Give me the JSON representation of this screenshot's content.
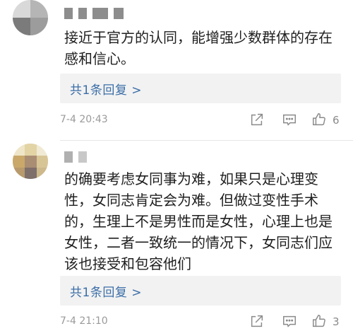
{
  "comments": [
    {
      "text_lines": [
        "接近于官方的认同，能增强少数群体的存在",
        "感和信心。"
      ],
      "reply_label": "共1条回复 >",
      "timestamp": "7-4 20:43",
      "like_count": "6",
      "icons": {
        "share": "share-icon",
        "comment": "comment-icon",
        "like": "thumbs-up-icon"
      }
    },
    {
      "text_lines": [
        "的确要考虑女同事为难，如果只是心理变",
        "性，女同志肯定会为难。但做过变性手术",
        "的，生理上不是男性而是女性，心理上也是",
        "女性，二者一致统一的情况下，女同志们应",
        "该也接受和包容他们"
      ],
      "reply_label": "共1条回复 >",
      "timestamp": "7-4 21:10",
      "like_count": "3",
      "icons": {
        "share": "share-icon",
        "comment": "comment-icon",
        "like": "thumbs-up-icon"
      }
    }
  ],
  "colors": {
    "reply_link": "#3b6ea8",
    "meta_text": "#9a9a9a",
    "reply_bg": "#f2f2f2"
  }
}
